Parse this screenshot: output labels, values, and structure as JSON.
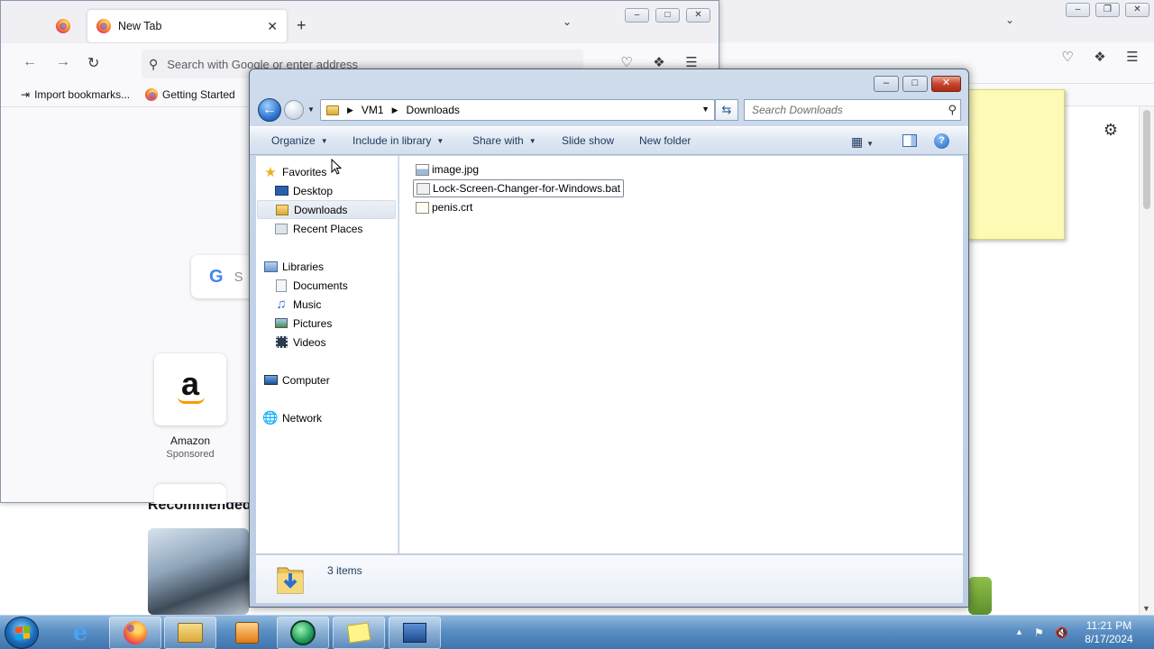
{
  "browser_bg": {
    "recommended_label": "Recommended"
  },
  "browser": {
    "tab_title": "New Tab",
    "address_placeholder": "Search with Google or enter address",
    "bookmarks": [
      "Import bookmarks...",
      "Getting Started"
    ],
    "search_partial": "S",
    "shortcut": {
      "name": "Amazon",
      "sub": "Sponsored",
      "glyph": "a"
    }
  },
  "explorer": {
    "breadcrumb": [
      "VM1",
      "Downloads"
    ],
    "search_placeholder": "Search Downloads",
    "commands": [
      "Organize",
      "Include in library",
      "Share with",
      "Slide show",
      "New folder"
    ],
    "nav": {
      "favorites": "Favorites",
      "favorites_items": [
        "Desktop",
        "Downloads",
        "Recent Places"
      ],
      "libraries": "Libraries",
      "libraries_items": [
        "Documents",
        "Music",
        "Pictures",
        "Videos"
      ],
      "computer": "Computer",
      "network": "Network"
    },
    "files": [
      "image.jpg",
      "Lock-Screen-Changer-for-Windows.bat",
      "penis.crt"
    ],
    "item_count": "3 items"
  },
  "taskbar": {
    "time": "11:21 PM",
    "date": "8/17/2024"
  },
  "colors": {
    "taskbar": "#3f74ad",
    "explorer_frame": "#c1d2e7",
    "sticky": "#fdfab5"
  }
}
